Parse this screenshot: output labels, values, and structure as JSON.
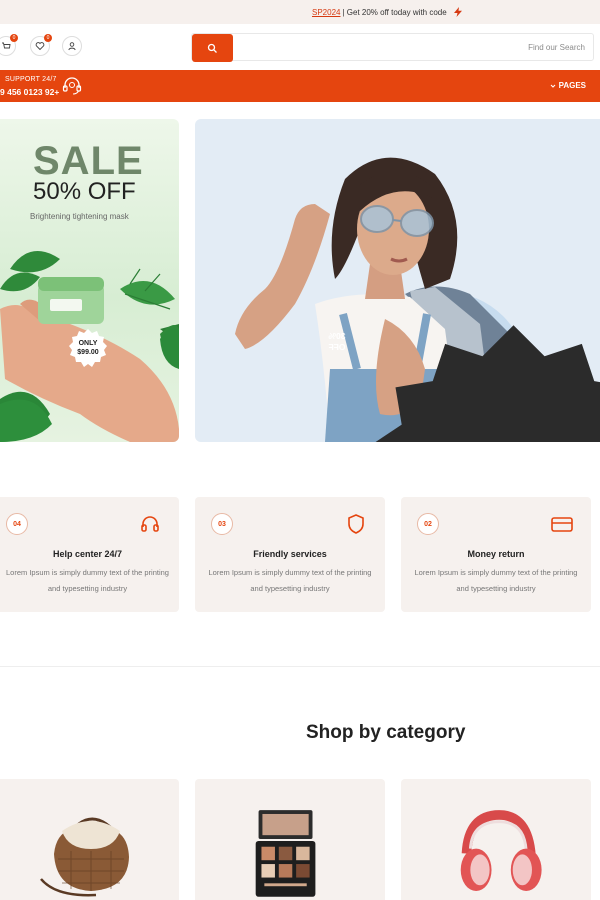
{
  "announcement": {
    "code": "SP2024",
    "text": " | Get 20% off today with code",
    "bolt_icon": "lightning-icon"
  },
  "header": {
    "icons": [
      {
        "name": "cart-icon",
        "badge": "0"
      },
      {
        "name": "heart-icon",
        "badge": "0"
      },
      {
        "name": "user-icon"
      }
    ],
    "search": {
      "placeholder": "Find our Search",
      "button_icon": "search-icon"
    }
  },
  "navbar": {
    "support_label": "SUPPORT 24/7",
    "support_phone": "9 456 0123 92+",
    "headset_icon": "headset-icon",
    "pages_label": "PAGES",
    "color": "#e5450f"
  },
  "promo": {
    "headline": "SALE",
    "discount": "50% OFF",
    "subtitle": "Brightening tightening mask",
    "price_badge": [
      "ONLY",
      "$99.00"
    ]
  },
  "hero": {
    "badge_text": [
      "30%",
      "OFF"
    ]
  },
  "features": [
    {
      "number": "04",
      "icon": "headphones-icon",
      "title": "Help center 24/7",
      "desc": "Lorem Ipsum is simply dummy text of the printing and typesetting industry"
    },
    {
      "number": "03",
      "icon": "shield-icon",
      "title": "Friendly services",
      "desc": "Lorem Ipsum is simply dummy text of the printing and typesetting industry"
    },
    {
      "number": "02",
      "icon": "credit-card-icon",
      "title": "Money return",
      "desc": "Lorem Ipsum is simply dummy text of the printing and typesetting industry"
    }
  ],
  "categories": {
    "title": "Shop by category",
    "items": [
      {
        "image": "handbag-image"
      },
      {
        "image": "makeup-palette-image"
      },
      {
        "image": "headphones-image"
      }
    ]
  },
  "colors": {
    "accent": "#e5450f",
    "card_bg": "#f6f1ee",
    "hero_bg": "#e3ecf5"
  }
}
